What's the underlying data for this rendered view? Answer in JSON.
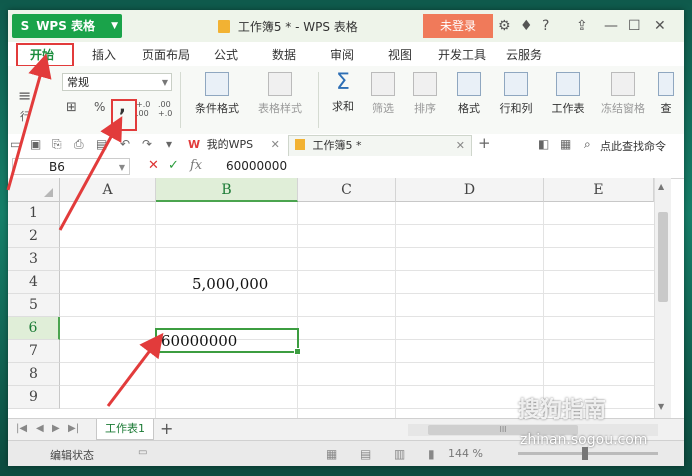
{
  "title": {
    "app": "WPS 表格",
    "doc": "工作簿5 * - WPS 表格",
    "login": "未登录",
    "help": "?"
  },
  "menu": [
    "开始",
    "插入",
    "页面布局",
    "公式",
    "数据",
    "审阅",
    "视图",
    "开发工具",
    "云服务"
  ],
  "ribbon": {
    "format_combo": "常规",
    "wrap_label": "行",
    "percent": "%",
    "comma": ",",
    "dec_inc": "+.0 .00",
    "dec_dec": ".00 +.0",
    "cond_format": "条件格式",
    "table_style": "表格样式",
    "sum": "求和",
    "filter": "筛选",
    "sort": "排序",
    "format": "格式",
    "rowcol": "行和列",
    "sheet": "工作表",
    "freeze": "冻结窗格",
    "find": "查"
  },
  "quickbar": {
    "wps_tab": "我的WPS",
    "doc_tab": "工作簿5 *",
    "search": "点此查找命令",
    "add": "+"
  },
  "formula": {
    "cell_ref": "B6",
    "fx": "fx",
    "value": "60000000"
  },
  "grid": {
    "columns": [
      "A",
      "B",
      "C",
      "D",
      "E"
    ],
    "rows": [
      "1",
      "2",
      "3",
      "4",
      "5",
      "6",
      "7",
      "8",
      "9"
    ],
    "b4": "5,000,000",
    "b6": "60000000"
  },
  "sheets": {
    "tab": "工作表1",
    "add": "+",
    "hscroll_label": "III"
  },
  "status": {
    "mode": "编辑状态",
    "zoom": "144 %"
  },
  "watermark": {
    "brand": "搜狗指南",
    "url": "zhinan.sogou.com"
  },
  "colors": {
    "accent_green": "#1aa34a",
    "login_orange": "#f07a5a",
    "annotation_red": "#e23b3b"
  }
}
